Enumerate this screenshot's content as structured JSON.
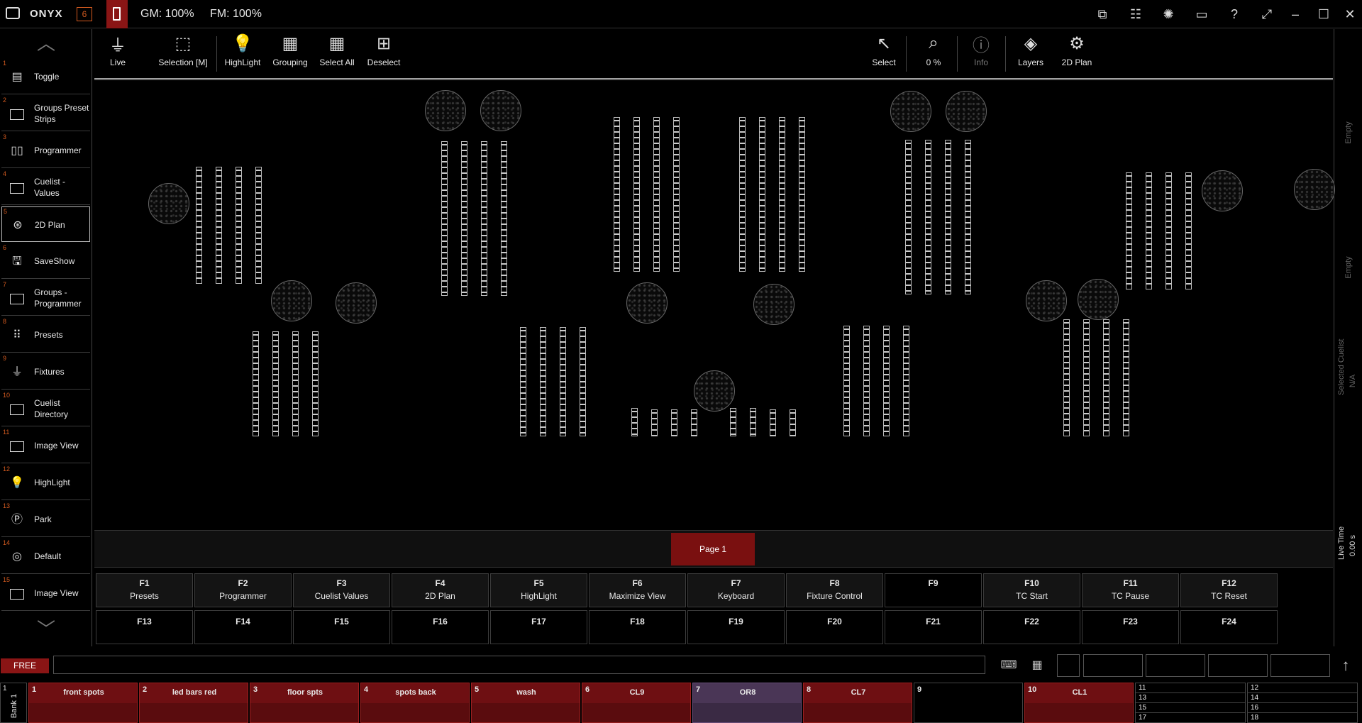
{
  "titlebar": {
    "app_name": "ONYX",
    "badge": "6",
    "gm": "GM: 100%",
    "fm": "FM: 100%",
    "icons": [
      "monitors-icon",
      "faders-icon",
      "brightness-icon",
      "chat-icon",
      "help-icon",
      "expand-icon",
      "minimize-icon",
      "maximize-icon",
      "close-icon"
    ]
  },
  "sidebar": {
    "items": [
      {
        "num": "1",
        "label": "Toggle",
        "icon": "toggle-icon"
      },
      {
        "num": "2",
        "label": "Groups Preset Strips",
        "icon": "window-icon"
      },
      {
        "num": "3",
        "label": "Programmer",
        "icon": "programmer-icon"
      },
      {
        "num": "4",
        "label": "Cuelist - Values",
        "icon": "window-icon"
      },
      {
        "num": "5",
        "label": "2D Plan",
        "icon": "plan-icon",
        "selected": true
      },
      {
        "num": "6",
        "label": "SaveShow",
        "icon": "save-icon"
      },
      {
        "num": "7",
        "label": "Groups - Programmer",
        "icon": "window-icon"
      },
      {
        "num": "8",
        "label": "Presets",
        "icon": "presets-icon"
      },
      {
        "num": "9",
        "label": "Fixtures",
        "icon": "fixture-icon"
      },
      {
        "num": "10",
        "label": "Cuelist Directory",
        "icon": "window-icon"
      },
      {
        "num": "11",
        "label": "Image View",
        "icon": "window-icon"
      },
      {
        "num": "12",
        "label": "HighLight",
        "icon": "bulb-icon"
      },
      {
        "num": "13",
        "label": "Park",
        "icon": "park-icon"
      },
      {
        "num": "14",
        "label": "Default",
        "icon": "default-icon"
      },
      {
        "num": "15",
        "label": "Image View",
        "icon": "window-icon"
      }
    ]
  },
  "toolbar": {
    "live": "Live",
    "selection": "Selection [M]",
    "highlight": "HighLight",
    "grouping": "Grouping",
    "select_all": "Select All",
    "deselect": "Deselect",
    "select": "Select",
    "zoom": "0 %",
    "info": "Info",
    "layers": "Layers",
    "plan": "2D Plan"
  },
  "rightpanel": {
    "empty1": "Empty",
    "empty2": "Empty",
    "selected_cuelist": "Selected Cuelist",
    "na": "N/A",
    "live_time": "Live Time",
    "live_time_val": "0.00 s"
  },
  "page": {
    "label": "Page 1"
  },
  "fkeys": {
    "row1": [
      {
        "key": "F1",
        "label": "Presets"
      },
      {
        "key": "F2",
        "label": "Programmer"
      },
      {
        "key": "F3",
        "label": "Cuelist Values"
      },
      {
        "key": "F4",
        "label": "2D Plan"
      },
      {
        "key": "F5",
        "label": "HighLight"
      },
      {
        "key": "F6",
        "label": "Maximize View"
      },
      {
        "key": "F7",
        "label": "Keyboard"
      },
      {
        "key": "F8",
        "label": "Fixture Control"
      },
      {
        "key": "F9",
        "label": ""
      },
      {
        "key": "F10",
        "label": "TC Start"
      },
      {
        "key": "F11",
        "label": "TC Pause"
      },
      {
        "key": "F12",
        "label": "TC Reset"
      }
    ],
    "row2": [
      "F13",
      "F14",
      "F15",
      "F16",
      "F17",
      "F18",
      "F19",
      "F20",
      "F21",
      "F22",
      "F23",
      "F24"
    ]
  },
  "cmdline": {
    "free": "FREE",
    "value": ""
  },
  "bank": {
    "id": "1",
    "name": "Bank 1",
    "cuelists": [
      {
        "num": "1",
        "name": "front spots",
        "style": "red"
      },
      {
        "num": "2",
        "name": "led bars red",
        "style": "red"
      },
      {
        "num": "3",
        "name": "floor spts",
        "style": "red"
      },
      {
        "num": "4",
        "name": "spots back",
        "style": "red"
      },
      {
        "num": "5",
        "name": "wash",
        "style": "red"
      },
      {
        "num": "6",
        "name": "CL9",
        "style": "red"
      },
      {
        "num": "7",
        "name": "OR8",
        "style": "purple"
      },
      {
        "num": "8",
        "name": "CL7",
        "style": "red"
      },
      {
        "num": "9",
        "name": "",
        "style": "blank"
      },
      {
        "num": "10",
        "name": "CL1",
        "style": "red"
      }
    ],
    "list_a": [
      "11",
      "13",
      "15",
      "17"
    ],
    "list_b": [
      "12",
      "14",
      "16",
      "18"
    ]
  }
}
